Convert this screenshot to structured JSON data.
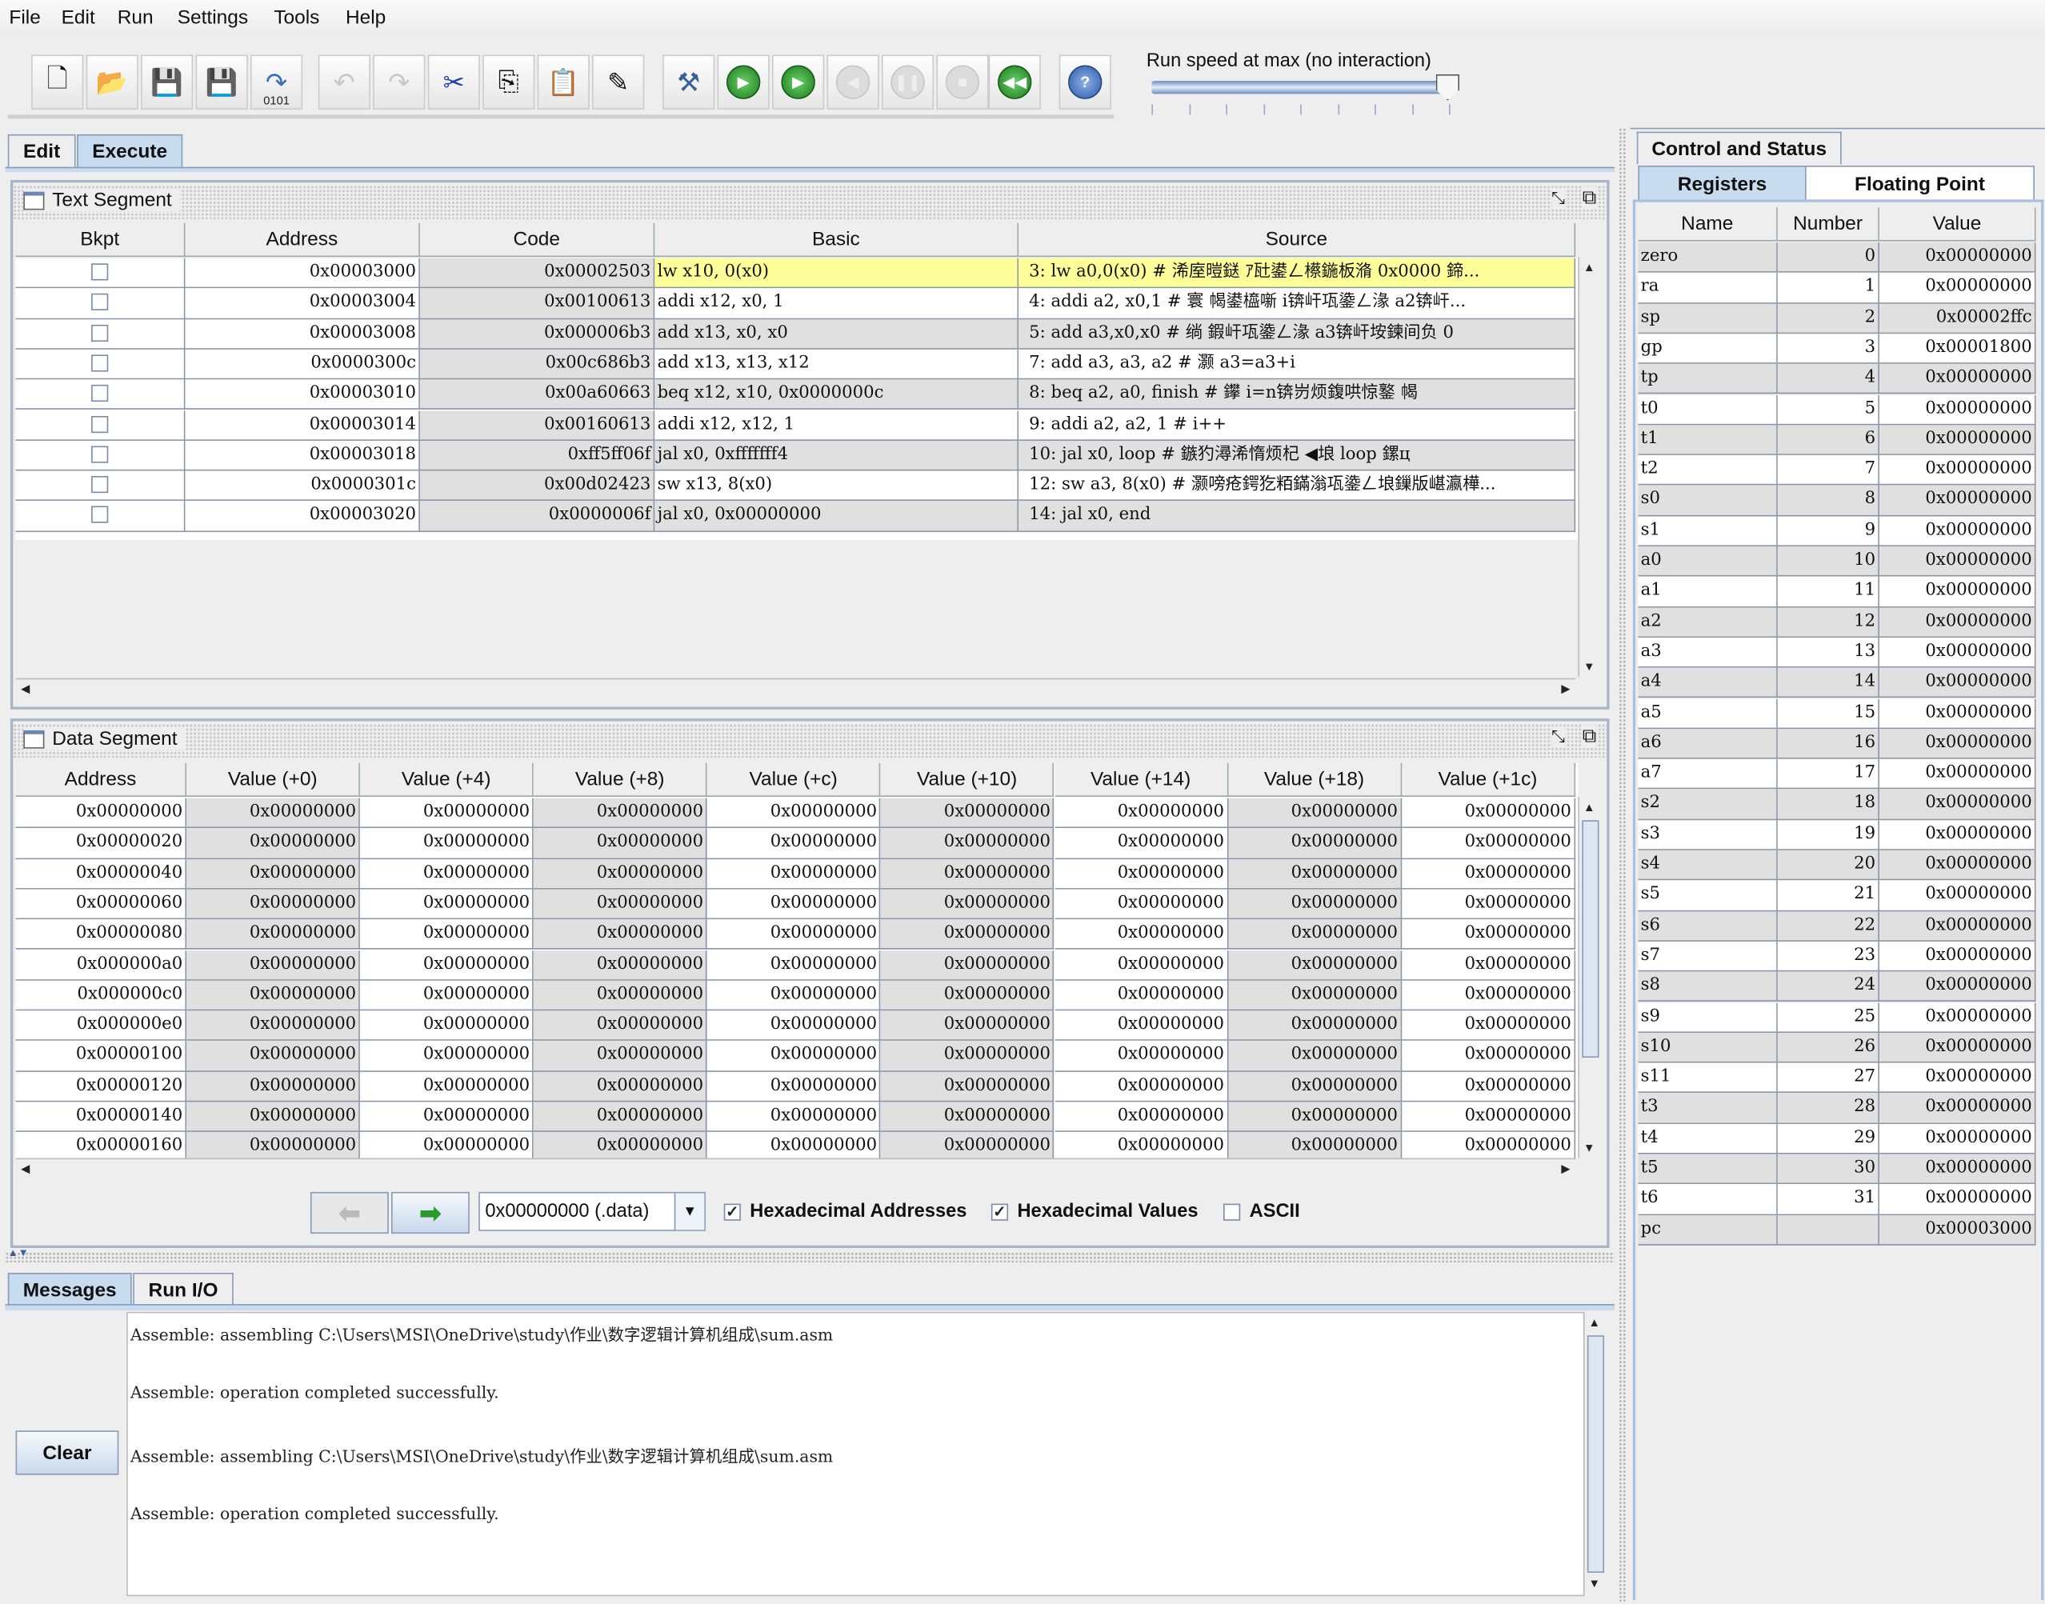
{
  "menu": [
    "File",
    "Edit",
    "Run",
    "Settings",
    "Tools",
    "Help"
  ],
  "toolbar": {
    "buttons": [
      {
        "name": "new-file-icon",
        "enabled": true
      },
      {
        "name": "open-icon",
        "enabled": true
      },
      {
        "name": "save-icon",
        "enabled": true
      },
      {
        "name": "save-as-icon",
        "enabled": true
      },
      {
        "name": "dump-memory-icon",
        "enabled": true,
        "label": "0101"
      },
      {
        "name": "undo-icon",
        "enabled": false
      },
      {
        "name": "redo-icon",
        "enabled": false
      },
      {
        "name": "cut-icon",
        "enabled": true
      },
      {
        "name": "copy-icon",
        "enabled": true
      },
      {
        "name": "paste-icon",
        "enabled": true
      },
      {
        "name": "find-replace-icon",
        "enabled": true
      },
      {
        "name": "assemble-icon",
        "enabled": true
      },
      {
        "name": "run-icon",
        "enabled": true
      },
      {
        "name": "step-icon",
        "enabled": true
      },
      {
        "name": "backstep-icon",
        "enabled": false
      },
      {
        "name": "pause-icon",
        "enabled": false
      },
      {
        "name": "stop-icon",
        "enabled": false
      },
      {
        "name": "reset-icon",
        "enabled": true
      },
      {
        "name": "help-icon",
        "enabled": true
      }
    ],
    "run_speed_label": "Run speed at max (no interaction)",
    "run_speed_fraction": 1.0
  },
  "main_tabs": [
    {
      "label": "Edit",
      "selected": false
    },
    {
      "label": "Execute",
      "selected": true
    }
  ],
  "text_segment": {
    "title": "Text Segment",
    "columns": [
      "Bkpt",
      "Address",
      "Code",
      "Basic",
      "Source"
    ],
    "rows": [
      {
        "bkpt": false,
        "address": "0x00003000",
        "code": "0x00002503",
        "basic": "lw x10, 0(x0)",
        "source": "3: lw a0,0(x0) # 浠庢暟鎹 ｱ瓧鍙ㄥ櫒鍦板潃 0x0000 鍗...",
        "current": true
      },
      {
        "bkpt": false,
        "address": "0x00003004",
        "code": "0x00100613",
        "basic": "addi x12, x0, 1",
        "source": "4: addi a2, x0,1 # 寰   幆鍙橀噺 i锛屽瓨鍌ㄥ湪 a2锛屽..."
      },
      {
        "bkpt": false,
        "address": "0x00003008",
        "code": "0x000006b3",
        "basic": "add x13, x0, x0",
        "source": "5: add a3,x0,x0 # 绱 鍜屽瓨鍌ㄥ湪 a3锛屽垵鍊间负 0"
      },
      {
        "bkpt": false,
        "address": "0x0000300c",
        "code": "0x00c686b3",
        "basic": "add x13, x13, x12",
        "source": "7: add a3, a3, a2 # 灏    a3=a3+i"
      },
      {
        "bkpt": false,
        "address": "0x00003010",
        "code": "0x00a60663",
        "basic": "beq x12, x10, 0x0000000c",
        "source": "8: beq a2, a0, finish # 鑻    i=n锛岃烦鍑哄惊鐜   幆"
      },
      {
        "bkpt": false,
        "address": "0x00003014",
        "code": "0x00160613",
        "basic": "addi x12, x12, 1",
        "source": "9: addi a2, a2, 1 # i++"
      },
      {
        "bkpt": false,
        "address": "0x00003018",
        "code": "0xff5ff06f",
        "basic": "jal x0, 0xfffffff4",
        "source": "10: jal x0, loop # 鏃犳潯浠惰烦杞 ◀埌 loop 鏍ц"
      },
      {
        "bkpt": false,
        "address": "0x0000301c",
        "code": "0x00d02423",
        "basic": "sw x13, 8(x0)",
        "source": "12: sw a3, 8(x0) # 灏嗙疮鍔犵粨鏋滃瓨鍌ㄥ埌鏁版嵁瀛樺..."
      },
      {
        "bkpt": false,
        "address": "0x00003020",
        "code": "0x0000006f",
        "basic": "jal x0, 0x00000000",
        "source": "14: jal x0, end"
      }
    ]
  },
  "data_segment": {
    "title": "Data Segment",
    "columns": [
      "Address",
      "Value (+0)",
      "Value (+4)",
      "Value (+8)",
      "Value (+c)",
      "Value (+10)",
      "Value (+14)",
      "Value (+18)",
      "Value (+1c)"
    ],
    "rows": [
      {
        "address": "0x00000000",
        "values": [
          "0x00000000",
          "0x00000000",
          "0x00000000",
          "0x00000000",
          "0x00000000",
          "0x00000000",
          "0x00000000",
          "0x00000000"
        ]
      },
      {
        "address": "0x00000020",
        "values": [
          "0x00000000",
          "0x00000000",
          "0x00000000",
          "0x00000000",
          "0x00000000",
          "0x00000000",
          "0x00000000",
          "0x00000000"
        ]
      },
      {
        "address": "0x00000040",
        "values": [
          "0x00000000",
          "0x00000000",
          "0x00000000",
          "0x00000000",
          "0x00000000",
          "0x00000000",
          "0x00000000",
          "0x00000000"
        ]
      },
      {
        "address": "0x00000060",
        "values": [
          "0x00000000",
          "0x00000000",
          "0x00000000",
          "0x00000000",
          "0x00000000",
          "0x00000000",
          "0x00000000",
          "0x00000000"
        ]
      },
      {
        "address": "0x00000080",
        "values": [
          "0x00000000",
          "0x00000000",
          "0x00000000",
          "0x00000000",
          "0x00000000",
          "0x00000000",
          "0x00000000",
          "0x00000000"
        ]
      },
      {
        "address": "0x000000a0",
        "values": [
          "0x00000000",
          "0x00000000",
          "0x00000000",
          "0x00000000",
          "0x00000000",
          "0x00000000",
          "0x00000000",
          "0x00000000"
        ]
      },
      {
        "address": "0x000000c0",
        "values": [
          "0x00000000",
          "0x00000000",
          "0x00000000",
          "0x00000000",
          "0x00000000",
          "0x00000000",
          "0x00000000",
          "0x00000000"
        ]
      },
      {
        "address": "0x000000e0",
        "values": [
          "0x00000000",
          "0x00000000",
          "0x00000000",
          "0x00000000",
          "0x00000000",
          "0x00000000",
          "0x00000000",
          "0x00000000"
        ]
      },
      {
        "address": "0x00000100",
        "values": [
          "0x00000000",
          "0x00000000",
          "0x00000000",
          "0x00000000",
          "0x00000000",
          "0x00000000",
          "0x00000000",
          "0x00000000"
        ]
      },
      {
        "address": "0x00000120",
        "values": [
          "0x00000000",
          "0x00000000",
          "0x00000000",
          "0x00000000",
          "0x00000000",
          "0x00000000",
          "0x00000000",
          "0x00000000"
        ]
      },
      {
        "address": "0x00000140",
        "values": [
          "0x00000000",
          "0x00000000",
          "0x00000000",
          "0x00000000",
          "0x00000000",
          "0x00000000",
          "0x00000000",
          "0x00000000"
        ]
      },
      {
        "address": "0x00000160",
        "values": [
          "0x00000000",
          "0x00000000",
          "0x00000000",
          "0x00000000",
          "0x00000000",
          "0x00000000",
          "0x00000000",
          "0x00000000"
        ]
      }
    ],
    "segment_select": "0x00000000 (.data)",
    "hex_addresses_label": "Hexadecimal Addresses",
    "hex_addresses_checked": true,
    "hex_values_label": "Hexadecimal Values",
    "hex_values_checked": true,
    "ascii_label": "ASCII",
    "ascii_checked": false
  },
  "bottom_tabs": [
    {
      "label": "Messages",
      "selected": true
    },
    {
      "label": "Run I/O",
      "selected": false
    }
  ],
  "messages": {
    "clear_label": "Clear",
    "lines": [
      "Assemble: assembling C:\\Users\\MSI\\OneDrive\\study\\作业\\数字逻辑计算机组成\\sum.asm",
      "Assemble: operation completed successfully.",
      "Assemble: assembling C:\\Users\\MSI\\OneDrive\\study\\作业\\数字逻辑计算机组成\\sum.asm",
      "Assemble: operation completed successfully."
    ]
  },
  "right_panel": {
    "top_tab": "Control and Status",
    "tabs": [
      {
        "label": "Registers",
        "selected": true
      },
      {
        "label": "Floating Point",
        "selected": false
      }
    ],
    "columns": [
      "Name",
      "Number",
      "Value"
    ],
    "registers": [
      [
        "zero",
        "0",
        "0x00000000"
      ],
      [
        "ra",
        "1",
        "0x00000000"
      ],
      [
        "sp",
        "2",
        "0x00002ffc"
      ],
      [
        "gp",
        "3",
        "0x00001800"
      ],
      [
        "tp",
        "4",
        "0x00000000"
      ],
      [
        "t0",
        "5",
        "0x00000000"
      ],
      [
        "t1",
        "6",
        "0x00000000"
      ],
      [
        "t2",
        "7",
        "0x00000000"
      ],
      [
        "s0",
        "8",
        "0x00000000"
      ],
      [
        "s1",
        "9",
        "0x00000000"
      ],
      [
        "a0",
        "10",
        "0x00000000"
      ],
      [
        "a1",
        "11",
        "0x00000000"
      ],
      [
        "a2",
        "12",
        "0x00000000"
      ],
      [
        "a3",
        "13",
        "0x00000000"
      ],
      [
        "a4",
        "14",
        "0x00000000"
      ],
      [
        "a5",
        "15",
        "0x00000000"
      ],
      [
        "a6",
        "16",
        "0x00000000"
      ],
      [
        "a7",
        "17",
        "0x00000000"
      ],
      [
        "s2",
        "18",
        "0x00000000"
      ],
      [
        "s3",
        "19",
        "0x00000000"
      ],
      [
        "s4",
        "20",
        "0x00000000"
      ],
      [
        "s5",
        "21",
        "0x00000000"
      ],
      [
        "s6",
        "22",
        "0x00000000"
      ],
      [
        "s7",
        "23",
        "0x00000000"
      ],
      [
        "s8",
        "24",
        "0x00000000"
      ],
      [
        "s9",
        "25",
        "0x00000000"
      ],
      [
        "s10",
        "26",
        "0x00000000"
      ],
      [
        "s11",
        "27",
        "0x00000000"
      ],
      [
        "t3",
        "28",
        "0x00000000"
      ],
      [
        "t4",
        "29",
        "0x00000000"
      ],
      [
        "t5",
        "30",
        "0x00000000"
      ],
      [
        "t6",
        "31",
        "0x00000000"
      ],
      [
        "pc",
        "",
        "0x00003000"
      ]
    ]
  }
}
